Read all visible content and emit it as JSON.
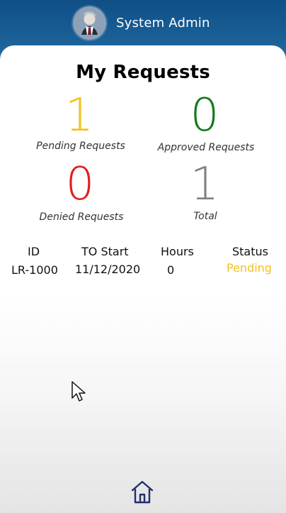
{
  "header": {
    "user_name": "System Admin"
  },
  "page": {
    "title": "My Requests"
  },
  "stats": [
    {
      "value": "1",
      "label": "Pending Requests",
      "color": "#f2c21b"
    },
    {
      "value": "0",
      "label": "Approved Requests",
      "color": "#0f7a18"
    },
    {
      "value": "0",
      "label": "Denied Requests",
      "color": "#e01f1f"
    },
    {
      "value": "1",
      "label": "Total",
      "color": "#808080"
    }
  ],
  "table": {
    "headers": [
      "ID",
      "TO Start",
      "Hours",
      "Status"
    ],
    "rows": [
      [
        "LR-1000",
        "11/12/2020",
        "0",
        "Pending"
      ]
    ]
  },
  "icons": {
    "cursor": "cursor-icon",
    "home": "home-icon",
    "avatar": "avatar-image"
  },
  "colors": {
    "header": "#0f4f86",
    "pending": "#f2c21b",
    "approved": "#0f7a18",
    "denied": "#e01f1f",
    "total": "#808080",
    "home": "#1f2f6f"
  }
}
